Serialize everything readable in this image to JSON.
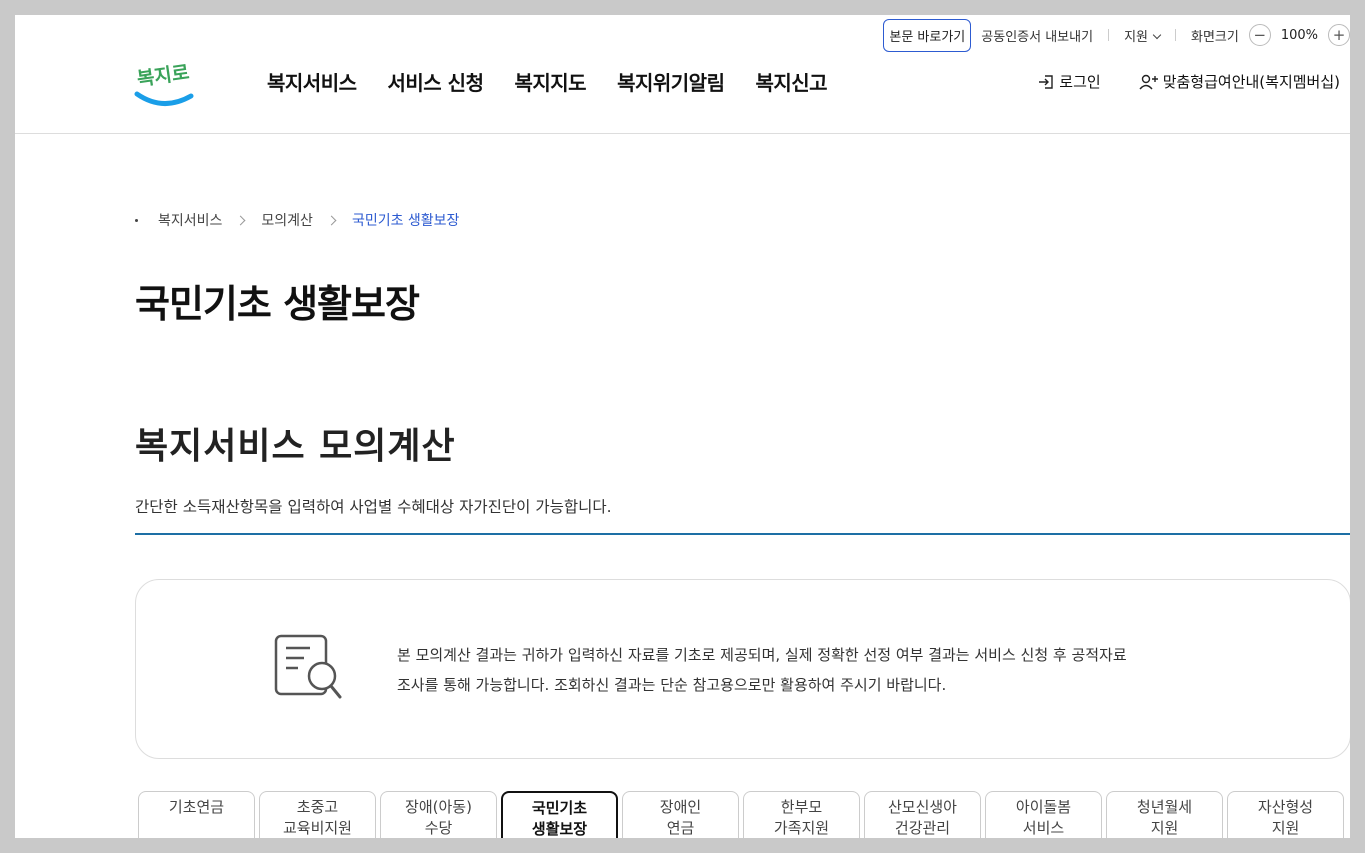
{
  "topbar": {
    "skip_label": "본문 바로가기",
    "cert_label": "공동인증서 내보내기",
    "support_label": "지원",
    "zoom_label": "화면크기",
    "zoom_value": "100%",
    "zoom_out": "−",
    "zoom_in": "+"
  },
  "logo": {
    "text": "복지로",
    "accent_color": "#1a9ee8",
    "text_color": "#3aa35a"
  },
  "gnb": {
    "items": [
      {
        "label": "복지서비스"
      },
      {
        "label": "서비스 신청"
      },
      {
        "label": "복지지도"
      },
      {
        "label": "복지위기알림"
      },
      {
        "label": "복지신고"
      }
    ]
  },
  "util": {
    "login_label": "로그인",
    "member_label": "맞춤형급여안내(복지멤버십)"
  },
  "breadcrumb": {
    "items": [
      {
        "label": "복지서비스"
      },
      {
        "label": "모의계산"
      },
      {
        "label": "국민기초 생활보장"
      }
    ]
  },
  "page_title": "국민기초 생활보장",
  "section": {
    "title": "복지서비스 모의계산",
    "desc": "간단한 소득재산항목을 입력하여 사업별 수혜대상 자가진단이 가능합니다."
  },
  "notice": {
    "icon": "document-search-icon",
    "line1": "본 모의계산 결과는 귀하가 입력하신 자료를 기초로 제공되며, 실제 정확한 선정 여부 결과는 서비스 신청 후 공적자료",
    "line2": "조사를 통해 가능합니다. 조회하신 결과는 단순 참고용으로만 활용하여 주시기 바랍니다."
  },
  "tabs": [
    {
      "line1": "기초연금",
      "line2": ""
    },
    {
      "line1": "초중고",
      "line2": "교육비지원"
    },
    {
      "line1": "장애(아동)",
      "line2": "수당"
    },
    {
      "line1": "국민기초",
      "line2": "생활보장",
      "active": true
    },
    {
      "line1": "장애인",
      "line2": "연금"
    },
    {
      "line1": "한부모",
      "line2": "가족지원"
    },
    {
      "line1": "산모신생아",
      "line2": "건강관리"
    },
    {
      "line1": "아이돌봄",
      "line2": "서비스"
    },
    {
      "line1": "청년월세",
      "line2": "지원"
    },
    {
      "line1": "자산형성",
      "line2": "지원"
    }
  ],
  "colors": {
    "primary": "#2d5bd1",
    "section_line": "#1d6fa5"
  }
}
